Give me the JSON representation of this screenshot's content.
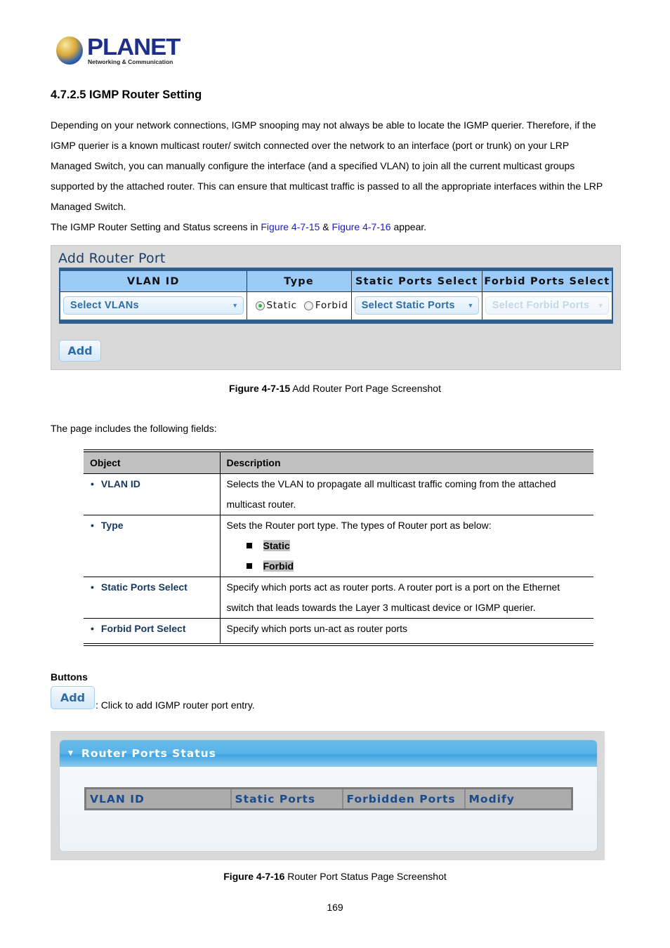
{
  "logo": {
    "brand": "PLANET",
    "tagline": "Networking & Communication"
  },
  "section_title": "4.7.2.5 IGMP Router Setting",
  "intro": {
    "lines": [
      "Depending on your network connections, IGMP snooping may not always be able to locate the IGMP querier. Therefore, if the",
      "IGMP querier is a known multicast router/ switch connected over the network to an interface (port or trunk) on your LRP",
      "Managed Switch, you can manually configure the interface (and a specified VLAN) to join all the current multicast groups",
      "supported by the attached router. This can ensure that multicast traffic is passed to all the appropriate interfaces within the LRP",
      "Managed Switch."
    ],
    "ref_prefix": "The IGMP Router Setting and Status screens in ",
    "ref_link1": "Figure 4-7-15",
    "ref_mid": " & ",
    "ref_link2": "Figure 4-7-16",
    "ref_suffix": " appear."
  },
  "add_router_port": {
    "title": "Add Router Port",
    "headers": [
      "VLAN ID",
      "Type",
      "Static Ports Select",
      "Forbid Ports Select"
    ],
    "vlan_select": "Select VLANs",
    "type_options": [
      {
        "label": "Static",
        "checked": true
      },
      {
        "label": "Forbid",
        "checked": false
      }
    ],
    "static_ports_select": "Select Static Ports",
    "forbid_ports_select": "Select Forbid Ports",
    "add_button": "Add"
  },
  "caption1": {
    "bold": "Figure 4-7-15",
    "text": " Add Router Port Page Screenshot"
  },
  "fields_intro": "The page includes the following fields:",
  "fields_table": {
    "headers": [
      "Object",
      "Description"
    ],
    "rows": [
      {
        "object": "VLAN ID",
        "description": [
          "Selects the VLAN to propagate all multicast traffic coming from the attached",
          "multicast router."
        ]
      },
      {
        "object": "Type",
        "description": [
          "Sets the Router port type. The types of Router port as below:"
        ],
        "sub_items": [
          "Static",
          "Forbid"
        ]
      },
      {
        "object": "Static Ports Select",
        "description": [
          "Specify which ports act as router ports. A router port is a port on the Ethernet",
          "switch that leads towards the Layer 3 multicast device or IGMP querier."
        ]
      },
      {
        "object": "Forbid Port Select",
        "description": [
          "Specify which ports un-act as router ports"
        ]
      }
    ]
  },
  "buttons_section": {
    "label": "Buttons",
    "add_button": "Add",
    "add_desc": ": Click to add IGMP router port entry."
  },
  "router_ports_status": {
    "title": "Router Ports Status",
    "headers": [
      "VLAN ID",
      "Static Ports",
      "Forbidden Ports",
      "Modify"
    ]
  },
  "caption2": {
    "bold": "Figure 4-7-16",
    "text": " Router Port Status Page Screenshot"
  },
  "page_number": "169"
}
